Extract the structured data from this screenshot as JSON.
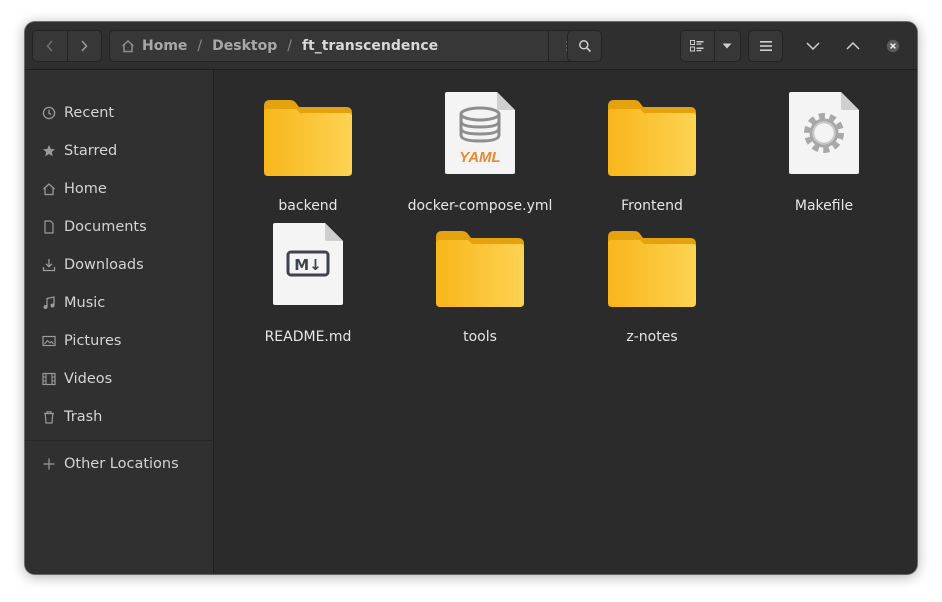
{
  "breadcrumb": {
    "items": [
      "Home",
      "Desktop",
      "ft_transcendence"
    ],
    "separator": "/"
  },
  "icons": {
    "back": "chevron-left-icon",
    "forward": "chevron-right-icon",
    "home": "home-icon",
    "path_menu": "vertical-dots-icon",
    "search": "search-icon",
    "view_list": "list-view-icon",
    "view_dropdown": "chevron-down-icon",
    "main_menu": "hamburger-menu-icon",
    "minimize": "chevron-down-icon",
    "maximize": "chevron-up-icon",
    "close": "close-icon"
  },
  "sidebar": {
    "items": [
      {
        "label": "Recent",
        "icon": "clock-icon"
      },
      {
        "label": "Starred",
        "icon": "star-icon"
      },
      {
        "label": "Home",
        "icon": "home-icon"
      },
      {
        "label": "Documents",
        "icon": "document-icon"
      },
      {
        "label": "Downloads",
        "icon": "download-icon"
      },
      {
        "label": "Music",
        "icon": "music-icon"
      },
      {
        "label": "Pictures",
        "icon": "picture-icon"
      },
      {
        "label": "Videos",
        "icon": "film-icon"
      },
      {
        "label": "Trash",
        "icon": "trash-icon"
      }
    ],
    "other_locations": {
      "label": "Other Locations",
      "icon": "plus-icon"
    }
  },
  "files": [
    {
      "name": "backend",
      "type": "folder"
    },
    {
      "name": "docker-compose.yml",
      "type": "yaml",
      "badge": "YAML"
    },
    {
      "name": "Frontend",
      "type": "folder"
    },
    {
      "name": "Makefile",
      "type": "makefile"
    },
    {
      "name": "README.md",
      "type": "markdown",
      "badge": "M↓"
    },
    {
      "name": "tools",
      "type": "folder"
    },
    {
      "name": "z-notes",
      "type": "folder"
    }
  ],
  "colors": {
    "folder": "#f8b61a",
    "folder_light": "#fdd353",
    "yaml_badge": "#e88a2d",
    "window_bg": "#2b2b2b",
    "sidebar_bg": "#303030"
  }
}
